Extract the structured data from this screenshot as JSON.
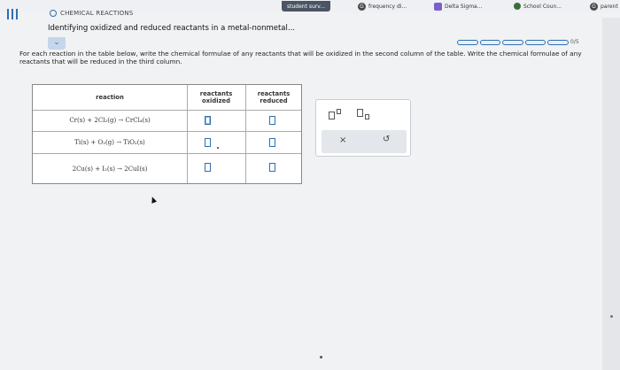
{
  "bookmarks": [
    {
      "label": "student surv..."
    },
    {
      "label": "frequency di..."
    },
    {
      "label": "Delta Sigma..."
    },
    {
      "label": "School Coun..."
    },
    {
      "label": "parent"
    }
  ],
  "header": {
    "topic": "CHEMICAL REACTIONS",
    "title": "Identifying oxidized and reduced reactants in a metal-nonmetal..."
  },
  "progress": {
    "text": "0/5",
    "segments": 5,
    "filled": 0
  },
  "instructions": "For each reaction in the table below, write the chemical formulae of any reactants that will be oxidized in the second column of the table. Write the chemical formulae of any reactants that will be reduced in the third column.",
  "table": {
    "headers": {
      "reaction": "reaction",
      "oxidized": "reactants oxidized",
      "reduced": "reactants reduced"
    },
    "rows": [
      {
        "reaction": "Cr(s) + 2Cl₂(g) → CrCl₄(s)"
      },
      {
        "reaction": "Ti(s) + O₂(g) → TiO₂(s)"
      },
      {
        "reaction": "2Cu(s) + I₂(s) → 2CuI(s)"
      }
    ]
  },
  "palette": {
    "clear_symbol": "×",
    "undo_symbol": "↺"
  },
  "icons": {
    "menu": "menu-icon",
    "collapse": "chevron-down-icon",
    "superscript": "superscript-icon",
    "subscript": "subscript-icon",
    "clear": "close-icon",
    "undo": "undo-icon"
  },
  "colors": {
    "accent": "#2f6fb0"
  }
}
